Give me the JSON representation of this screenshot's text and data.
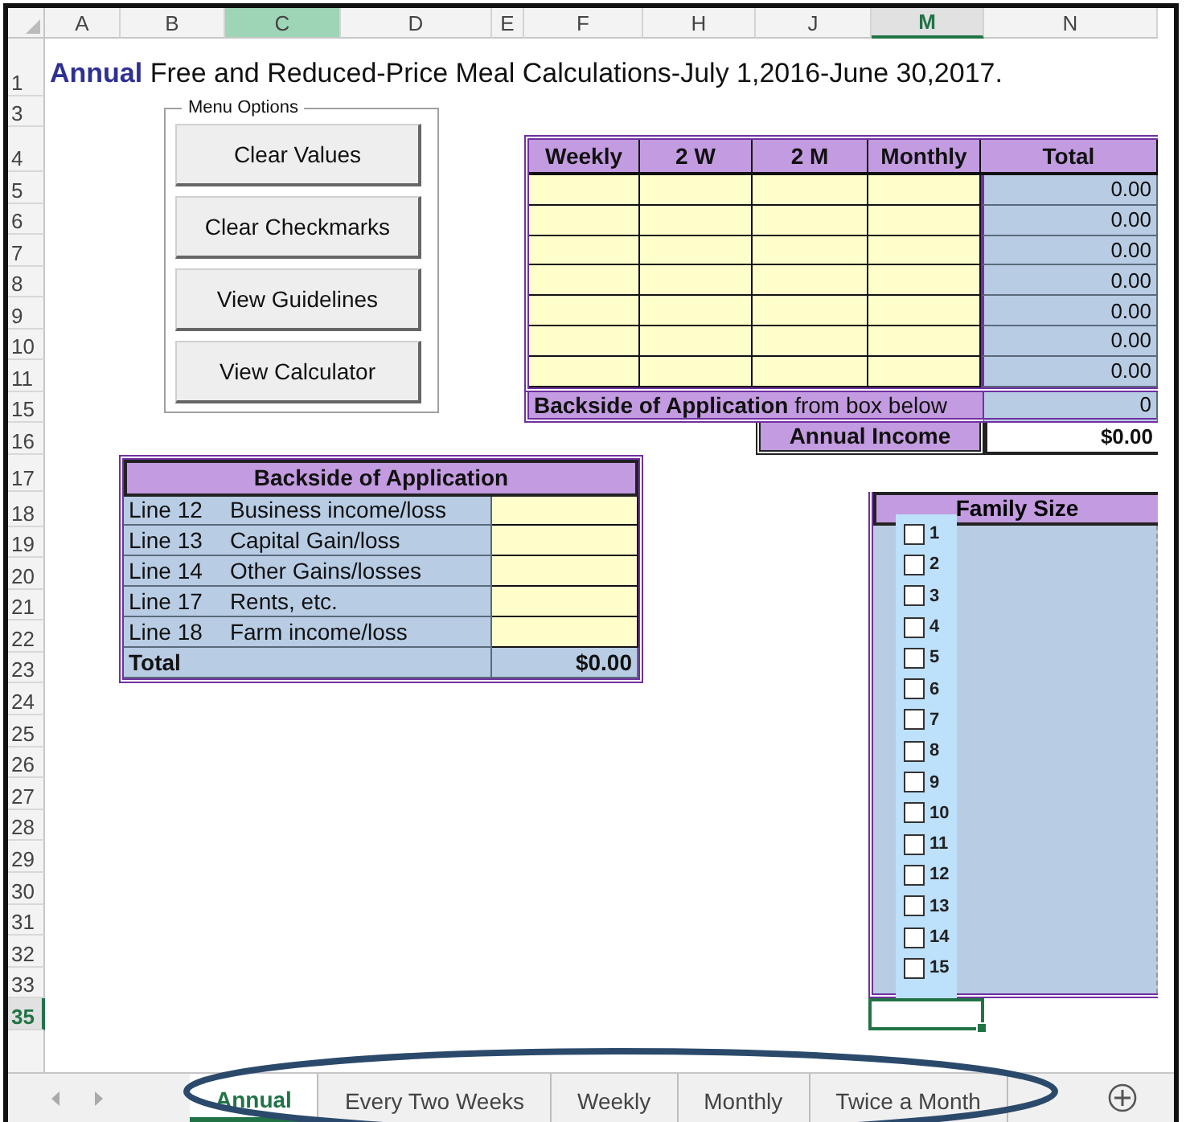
{
  "column_headers": [
    {
      "label": "A",
      "selected": false,
      "highlighted": false
    },
    {
      "label": "B",
      "selected": false,
      "highlighted": false
    },
    {
      "label": "C",
      "selected": false,
      "highlighted": true
    },
    {
      "label": "D",
      "selected": false,
      "highlighted": false
    },
    {
      "label": "E",
      "selected": false,
      "highlighted": false
    },
    {
      "label": "F",
      "selected": false,
      "highlighted": false
    },
    {
      "label": "H",
      "selected": false,
      "highlighted": false
    },
    {
      "label": "J",
      "selected": false,
      "highlighted": false
    },
    {
      "label": "M",
      "selected": true,
      "highlighted": false
    },
    {
      "label": "N",
      "selected": false,
      "highlighted": false
    }
  ],
  "row_headers": [
    {
      "label": "1",
      "selected": false
    },
    {
      "label": "3",
      "selected": false
    },
    {
      "label": "4",
      "selected": false
    },
    {
      "label": "5",
      "selected": false
    },
    {
      "label": "6",
      "selected": false
    },
    {
      "label": "7",
      "selected": false
    },
    {
      "label": "8",
      "selected": false
    },
    {
      "label": "9",
      "selected": false
    },
    {
      "label": "10",
      "selected": false
    },
    {
      "label": "11",
      "selected": false
    },
    {
      "label": "15",
      "selected": false
    },
    {
      "label": "16",
      "selected": false
    },
    {
      "label": "17",
      "selected": false
    },
    {
      "label": "18",
      "selected": false
    },
    {
      "label": "19",
      "selected": false
    },
    {
      "label": "20",
      "selected": false
    },
    {
      "label": "21",
      "selected": false
    },
    {
      "label": "22",
      "selected": false
    },
    {
      "label": "23",
      "selected": false
    },
    {
      "label": "24",
      "selected": false
    },
    {
      "label": "25",
      "selected": false
    },
    {
      "label": "26",
      "selected": false
    },
    {
      "label": "27",
      "selected": false
    },
    {
      "label": "28",
      "selected": false
    },
    {
      "label": "29",
      "selected": false
    },
    {
      "label": "30",
      "selected": false
    },
    {
      "label": "31",
      "selected": false
    },
    {
      "label": "32",
      "selected": false
    },
    {
      "label": "33",
      "selected": false
    },
    {
      "label": "35",
      "selected": true
    }
  ],
  "title": "**Annual** Free and Reduced-Price Meal Calculations-July 1,2016-June 30,2017.",
  "menu": {
    "title": "Menu Options",
    "buttons": [
      "Clear Values",
      "Clear Checkmarks",
      "View Guidelines",
      "View Calculator"
    ]
  },
  "income_table": {
    "columns": [
      "Weekly",
      "2 W",
      "2 M",
      "Monthly",
      "Total"
    ],
    "rows": [
      {
        "total": "0.00"
      },
      {
        "total": "0.00"
      },
      {
        "total": "0.00"
      },
      {
        "total": "0.00"
      },
      {
        "total": "0.00"
      },
      {
        "total": "0.00"
      },
      {
        "total": "0.00"
      }
    ],
    "backside_row": {
      "label": "**Backside of Application** from box below",
      "value": "0"
    },
    "annual_income": {
      "label": "Annual Income",
      "value": "$0.00"
    }
  },
  "backside_table": {
    "title": "Backside of Application",
    "rows": [
      {
        "line": "Line 12",
        "description": "Business income/loss"
      },
      {
        "line": "Line 13",
        "description": "Capital Gain/loss"
      },
      {
        "line": "Line 14",
        "description": "Other Gains/losses"
      },
      {
        "line": "Line 17",
        "description": "Rents, etc."
      },
      {
        "line": "Line 18",
        "description": "Farm income/loss"
      }
    ],
    "total": {
      "label": "Total",
      "value": "$0.00"
    }
  },
  "family_size": {
    "title": "Family Size",
    "options": [
      {
        "label": "1",
        "checked": false
      },
      {
        "label": "2",
        "checked": false
      },
      {
        "label": "3",
        "checked": false
      },
      {
        "label": "4",
        "checked": false
      },
      {
        "label": "5",
        "checked": false
      },
      {
        "label": "6",
        "checked": false
      },
      {
        "label": "7",
        "checked": false
      },
      {
        "label": "8",
        "checked": false
      },
      {
        "label": "9",
        "checked": false
      },
      {
        "label": "10",
        "checked": false
      },
      {
        "label": "11",
        "checked": false
      },
      {
        "label": "12",
        "checked": false
      },
      {
        "label": "13",
        "checked": false
      },
      {
        "label": "14",
        "checked": false
      },
      {
        "label": "15",
        "checked": false
      }
    ]
  },
  "sheet_tabs": [
    {
      "label": "Annual",
      "selected": true
    },
    {
      "label": "Every Two Weeks",
      "selected": false
    },
    {
      "label": "Weekly",
      "selected": false
    },
    {
      "label": "Monthly",
      "selected": false
    },
    {
      "label": "Twice a Month",
      "selected": false
    }
  ]
}
